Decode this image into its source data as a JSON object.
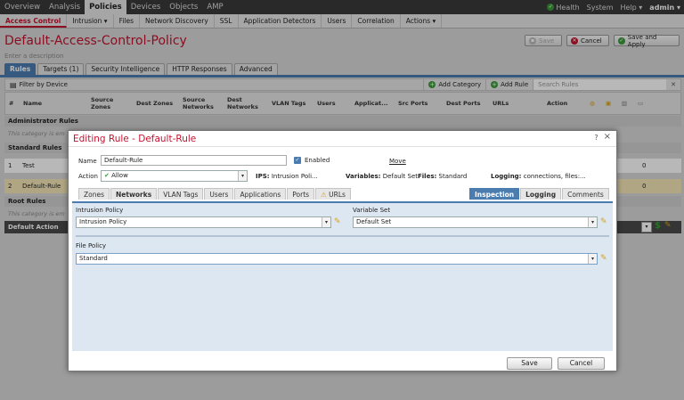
{
  "topnav": {
    "items": [
      "Overview",
      "Analysis",
      "Policies",
      "Devices",
      "Objects",
      "AMP"
    ],
    "active_index": 2,
    "health": "Health",
    "system": "System",
    "help": "Help ▾",
    "user": "admin ▾"
  },
  "subnav": {
    "items": [
      "Access Control",
      "Intrusion ▾",
      "Files",
      "Network Discovery",
      "SSL",
      "Application Detectors",
      "Users",
      "Correlation",
      "Actions ▾"
    ]
  },
  "page": {
    "title": "Default-Access-Control-Policy",
    "description_placeholder": "Enter a description",
    "buttons": {
      "save": "Save",
      "cancel": "Cancel",
      "save_apply": "Save and Apply"
    },
    "tabs": [
      "Rules",
      "Targets (1)",
      "Security Intelligence",
      "HTTP Responses",
      "Advanced"
    ]
  },
  "toolbar": {
    "filter": "Filter by Device",
    "add_category": "Add Category",
    "add_rule": "Add Rule",
    "search_placeholder": "Search Rules"
  },
  "table": {
    "columns": [
      "#",
      "Name",
      "Source Zones",
      "Dest Zones",
      "Source Networks",
      "Dest Networks",
      "VLAN Tags",
      "Users",
      "Applicat...",
      "Src Ports",
      "Dest Ports",
      "URLs",
      "Action"
    ],
    "sections": {
      "admin": "Administrator Rules",
      "standard": "Standard Rules",
      "root": "Root Rules",
      "empty_note": "This category is em"
    },
    "rows": [
      {
        "num": "1",
        "name": "Test",
        "count": "0"
      },
      {
        "num": "2",
        "name": "Default-Rule",
        "count": "0"
      }
    ],
    "default_action": "Default Action"
  },
  "modal": {
    "title": "Editing Rule - Default-Rule",
    "help": "?",
    "close": "×",
    "name_label": "Name",
    "name_value": "Default-Rule",
    "enabled_label": "Enabled",
    "move_link": "Move",
    "action_label": "Action",
    "action_value": "Allow",
    "ips_label": "IPS:",
    "ips_value": "Intrusion Poli...",
    "variables_label": "Variables:",
    "variables_value": "Default Set",
    "files_label": "Files:",
    "files_value": "Standard",
    "logging_label": "Logging:",
    "logging_value": "connections, files:...",
    "tabs_left": [
      "Zones",
      "Networks",
      "VLAN Tags",
      "Users",
      "Applications",
      "Ports",
      "URLs"
    ],
    "tabs_right": [
      "Inspection",
      "Logging",
      "Comments"
    ],
    "intrusion_policy_label": "Intrusion Policy",
    "intrusion_policy_value": "Intrusion Policy",
    "variable_set_label": "Variable Set",
    "variable_set_value": "Default Set",
    "file_policy_label": "File Policy",
    "file_policy_value": "Standard",
    "save": "Save",
    "cancel": "Cancel"
  },
  "colors": {
    "brand_red": "#c4122f",
    "tab_blue": "#4b7cb0",
    "nav_dark": "#3a3a3a"
  }
}
